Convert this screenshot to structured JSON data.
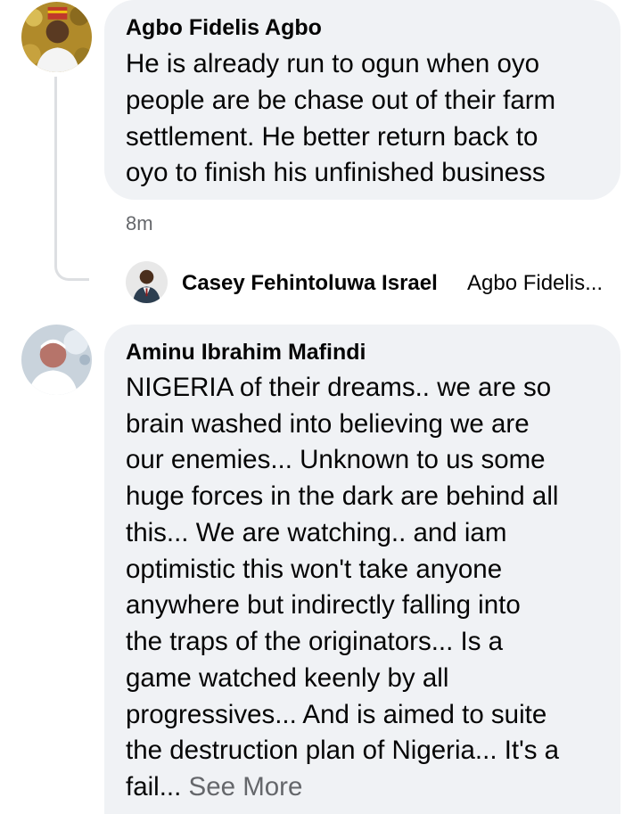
{
  "comments": [
    {
      "author": "Agbo Fidelis Agbo",
      "lines": [
        "He is already run to ogun when oyo",
        "people are be chase out of their farm",
        "settlement. He better return back to",
        "oyo to finish his unfinished business"
      ],
      "time": "8m",
      "reply": {
        "author": "Casey Fehintoluwa Israel",
        "preview": "Agbo Fidelis..."
      }
    },
    {
      "author": "Aminu Ibrahim Mafindi",
      "lines": [
        "NIGERIA of their dreams.. we are so",
        "brain washed into believing we are",
        "our enemies... Unknown to us some",
        "huge forces in the dark are behind all",
        "this... We are watching..  and iam",
        "optimistic this won't take anyone",
        "anywhere but indirectly falling into",
        "the traps of the originators... Is a",
        "game  watched keenly by all",
        "progressives... And is aimed to suite",
        "the destruction plan of Nigeria... It's a",
        "fail..."
      ],
      "see_more": "See More"
    }
  ]
}
